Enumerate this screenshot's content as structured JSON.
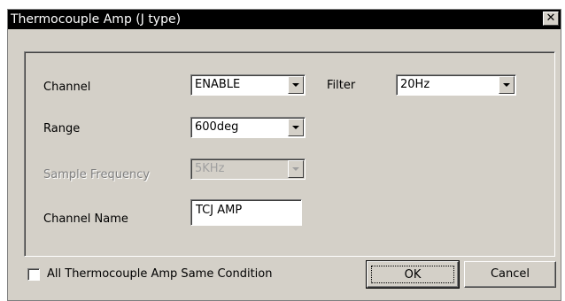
{
  "window": {
    "title": "Thermocouple Amp (J type)",
    "close_glyph": "✕"
  },
  "fields": {
    "channel": {
      "label": "Channel",
      "value": "ENABLE"
    },
    "filter": {
      "label": "Filter",
      "value": "20Hz"
    },
    "range": {
      "label": "Range",
      "value": "600deg"
    },
    "sample_frequency": {
      "label": "Sample Frequency",
      "value": "5KHz",
      "enabled": false
    },
    "channel_name": {
      "label": "Channel Name",
      "value": "TCJ AMP"
    }
  },
  "same_condition": {
    "label": "All Thermocouple Amp Same Condition",
    "checked": false
  },
  "buttons": {
    "ok": "OK",
    "cancel": "Cancel"
  }
}
